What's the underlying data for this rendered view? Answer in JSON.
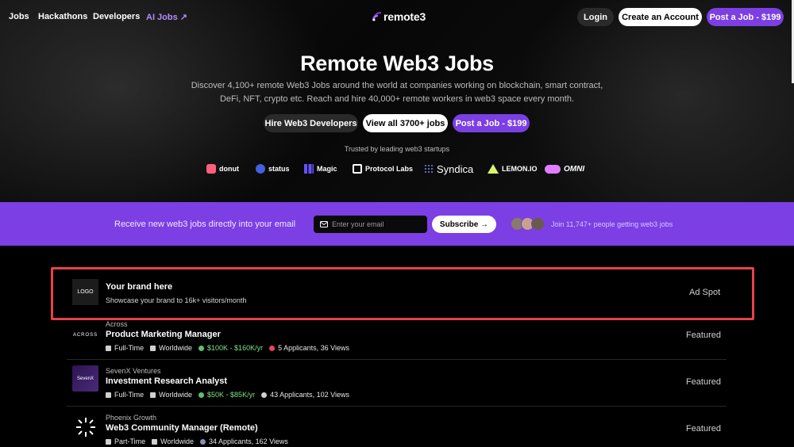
{
  "nav": {
    "links": [
      "Jobs",
      "Hackathons",
      "Developers",
      "AI Jobs ↗"
    ],
    "logo": "remote3",
    "login": "Login",
    "create_account": "Create an Account",
    "post_job": "Post a Job - $199"
  },
  "hero": {
    "title": "Remote Web3 Jobs",
    "description": "Discover 4,100+ remote Web3 Jobs around the world at companies working on blockchain, smart contract, DeFi, NFT, crypto etc. Reach and hire 40,000+ remote workers in web3 space every month.",
    "buttons": [
      "Hire Web3 Developers",
      "View all 3700+ jobs",
      "Post a Job - $199"
    ],
    "trusted_label": "Trusted by leading web3 startups",
    "partners": [
      "donut",
      "status",
      "Magic",
      "Protocol Labs",
      "Syndica",
      "LEMON.IO",
      "OMNI"
    ]
  },
  "subscribe": {
    "text": "Receive new web3 jobs directly into your email",
    "placeholder": "Enter your email",
    "button": "Subscribe →",
    "join_text": "Join 11,747+ people getting web3 jobs"
  },
  "ad": {
    "logo_text": "LOGO",
    "title": "Your brand here",
    "subtitle": "Showcase your brand to 16k+ visitors/month",
    "label": "Ad Spot"
  },
  "jobs": [
    {
      "company": "Across",
      "logo_text": "ACROSS",
      "title": "Product Marketing Manager",
      "type": "Full-Time",
      "location": "Worldwide",
      "salary": "$100K - $160K/yr",
      "stats": "5 Applicants, 36 Views",
      "badge": "Featured"
    },
    {
      "company": "SevenX Ventures",
      "logo_text": "SevenX",
      "title": "Investment Research Analyst",
      "type": "Full-Time",
      "location": "Worldwide",
      "salary": "$50K - $85K/yr",
      "stats": "43 Applicants, 102 Views",
      "badge": "Featured"
    },
    {
      "company": "Phoenix Growth",
      "logo_text": "",
      "title": "Web3 Community Manager (Remote)",
      "type": "Part-Time",
      "location": "Worldwide",
      "salary": "",
      "stats": "34 Applicants, 162 Views",
      "badge": "Featured"
    }
  ],
  "colors": {
    "accent": "#7b3fe4",
    "ad_border": "#e8424b",
    "salary": "#7ee085"
  }
}
